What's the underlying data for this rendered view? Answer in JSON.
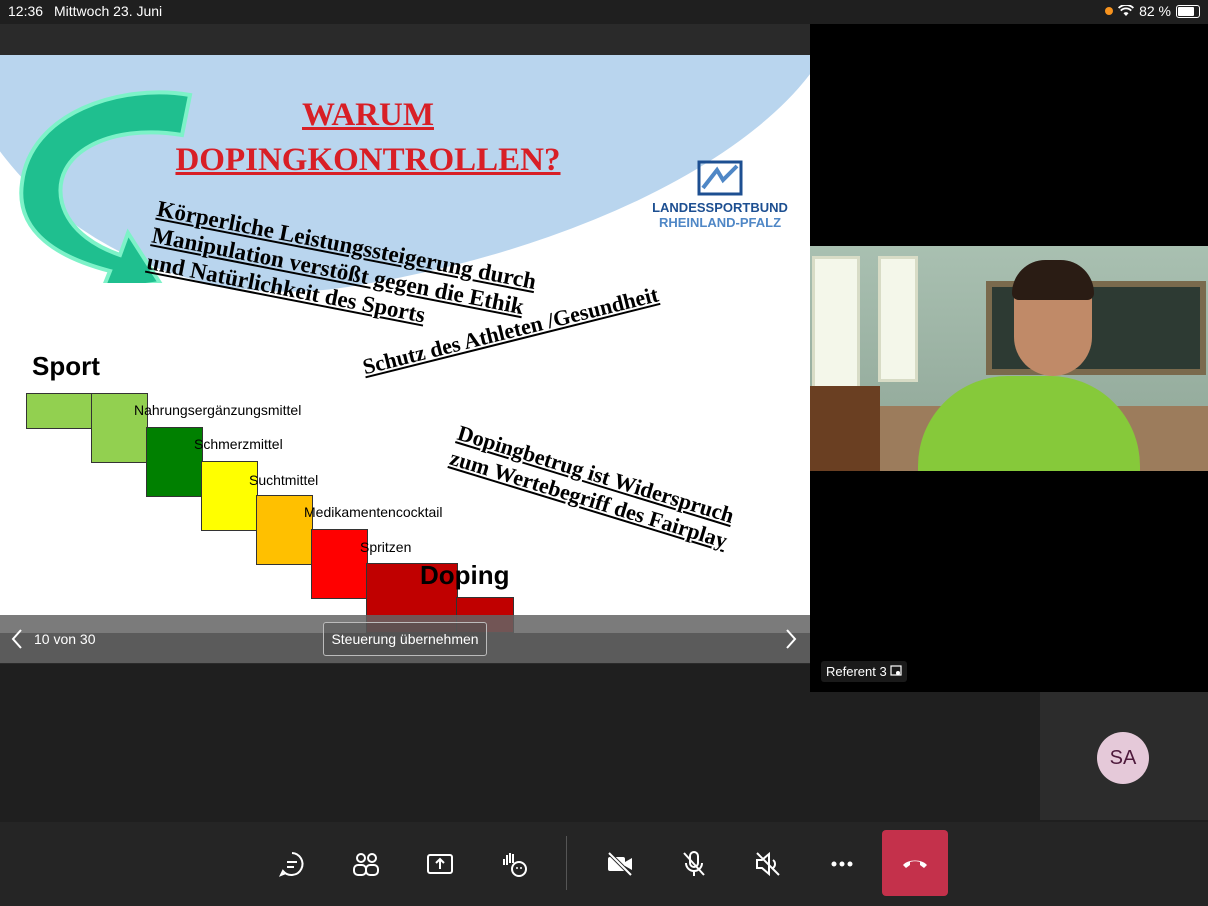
{
  "status_bar": {
    "time": "12:36",
    "date": "Mittwoch 23. Juni",
    "battery": "82 %"
  },
  "slide": {
    "title_line1": "WARUM",
    "title_line2": "DOPINGKONTROLLEN?",
    "logo_line1": "LANDESSPORTBUND",
    "logo_line2": "RHEINLAND-PFALZ",
    "statement1": [
      "Körperliche Leistungssteigerung durch",
      "Manipulation verstößt gegen die Ethik",
      "und Natürlichkeit des Sports"
    ],
    "statement2": "Schutz des Athleten /Gesundheit",
    "statement3": [
      "Dopingbetrug ist Widerspruch",
      "zum Wertebegriff des Fairplay"
    ],
    "staircase": {
      "start": "Sport",
      "end": "Doping",
      "steps": [
        "Nahrungsergänzungsmittel",
        "Schmerzmittel",
        "Suchtmittel",
        "Medikamentencocktail",
        "Spritzen"
      ],
      "colors": [
        "#92d050",
        "#92d050",
        "#008000",
        "#ffff00",
        "#ffc000",
        "#ff0000",
        "#c00000",
        "#c00000"
      ]
    },
    "nav": {
      "counter": "10 von 30",
      "take_control": "Steuerung übernehmen"
    }
  },
  "video": {
    "participant_label": "Referent 3"
  },
  "gallery": {
    "avatar_initials": "SA"
  },
  "colors": {
    "hangup": "#c4314b",
    "avatar_bg": "#e5c9d9",
    "title_red": "#d81f26"
  },
  "toolbar": {
    "icons": [
      "chat-icon",
      "participants-icon",
      "share-icon",
      "reactions-icon",
      "camera-off-icon",
      "mic-off-icon",
      "speaker-off-icon",
      "more-icon",
      "hangup-icon"
    ]
  }
}
